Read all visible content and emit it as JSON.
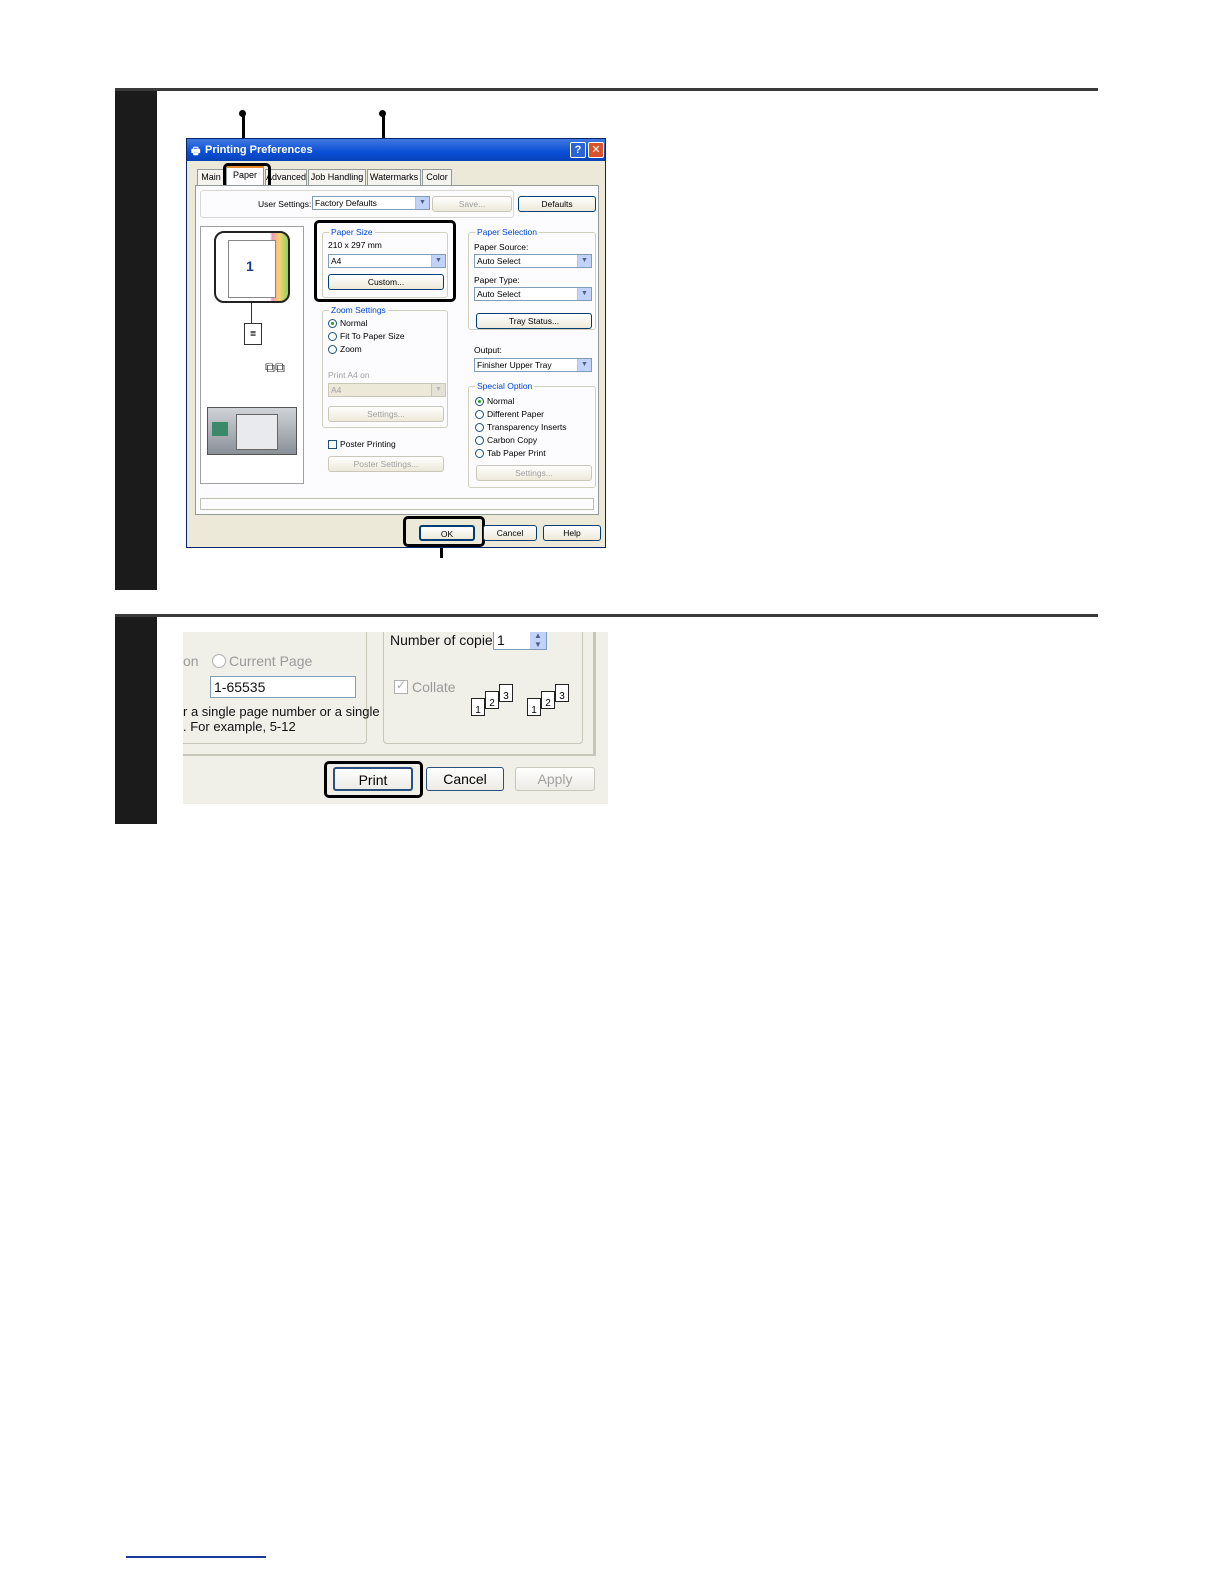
{
  "dialog1": {
    "title": "Printing Preferences",
    "help_btn": "?",
    "close_btn": "✕",
    "tabs": [
      "Main",
      "Paper",
      "Advanced",
      "Job Handling",
      "Watermarks",
      "Color"
    ],
    "user_settings_label": "User Settings:",
    "user_settings_value": "Factory Defaults",
    "save_label": "Save...",
    "defaults_label": "Defaults",
    "preview_page_number": "1",
    "paper_size": {
      "group_label": "Paper Size",
      "dimensions": "210 x 297 mm",
      "value": "A4",
      "custom_label": "Custom..."
    },
    "zoom": {
      "group_label": "Zoom Settings",
      "options": [
        "Normal",
        "Fit To Paper Size",
        "Zoom"
      ],
      "print_on_label": "Print A4 on",
      "print_on_value": "A4",
      "settings_label": "Settings..."
    },
    "poster": {
      "label": "Poster Printing",
      "settings_label": "Poster Settings..."
    },
    "paper_selection": {
      "group_label": "Paper Selection",
      "source_label": "Paper Source:",
      "source_value": "Auto Select",
      "type_label": "Paper Type:",
      "type_value": "Auto Select",
      "tray_status_label": "Tray Status..."
    },
    "output": {
      "label": "Output:",
      "value": "Finisher Upper Tray"
    },
    "special_option": {
      "group_label": "Special Option",
      "options": [
        "Normal",
        "Different Paper",
        "Transparency Inserts",
        "Carbon Copy",
        "Tab Paper Print"
      ],
      "settings_label": "Settings..."
    },
    "footer": {
      "ok": "OK",
      "cancel": "Cancel",
      "help": "Help"
    }
  },
  "dialog2": {
    "partial_label": "on",
    "current_page_label": "Current Page",
    "pages_value": "1-65535",
    "hint_line1": "r a single page number or a single",
    "hint_line2": ".  For example, 5-12",
    "copies_label": "Number of copies:",
    "copies_value": "1",
    "collate_label": "Collate",
    "collate_pages": [
      "1",
      "2",
      "3"
    ],
    "print": "Print",
    "cancel": "Cancel",
    "apply": "Apply"
  },
  "colors": {
    "title_bar": "#0a4ed6",
    "accent_tab": "#e68b2c",
    "group_label": "#0046d5"
  }
}
